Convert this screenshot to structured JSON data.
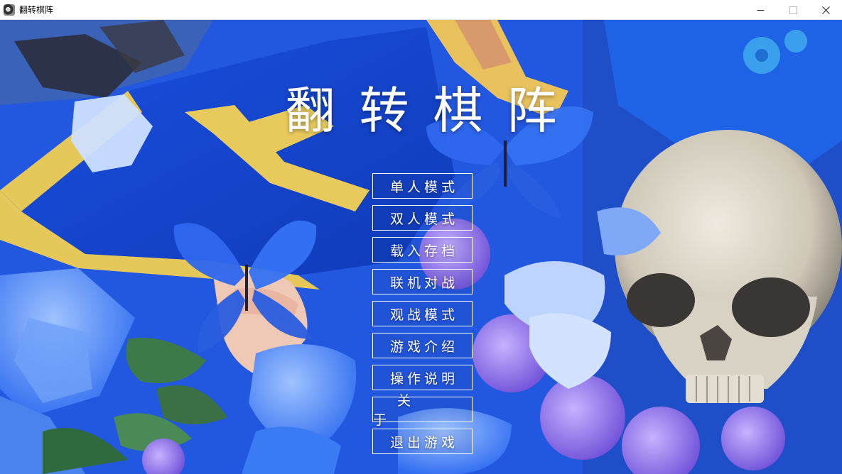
{
  "window": {
    "title": "翻转棋阵",
    "controls": [
      "minimize-icon",
      "maximize-icon",
      "close-icon"
    ]
  },
  "game": {
    "title": "翻转棋阵"
  },
  "menu": {
    "items": [
      {
        "label": "单人模式",
        "name": "single-player-button"
      },
      {
        "label": "双人模式",
        "name": "two-player-button"
      },
      {
        "label": "载入存档",
        "name": "load-save-button"
      },
      {
        "label": "联机对战",
        "name": "online-battle-button"
      },
      {
        "label": "观战模式",
        "name": "spectate-mode-button"
      },
      {
        "label": "游戏介绍",
        "name": "game-intro-button"
      },
      {
        "label": "操作说明",
        "name": "instructions-button"
      },
      {
        "label": "关于",
        "name": "about-button"
      },
      {
        "label": "退出游戏",
        "name": "exit-game-button"
      }
    ]
  },
  "colors": {
    "background_blue": "#1d4fd6",
    "accent_yellow": "#e6c85a",
    "petal_purple": "#8a6fe0",
    "menu_border": "#ffffff"
  }
}
